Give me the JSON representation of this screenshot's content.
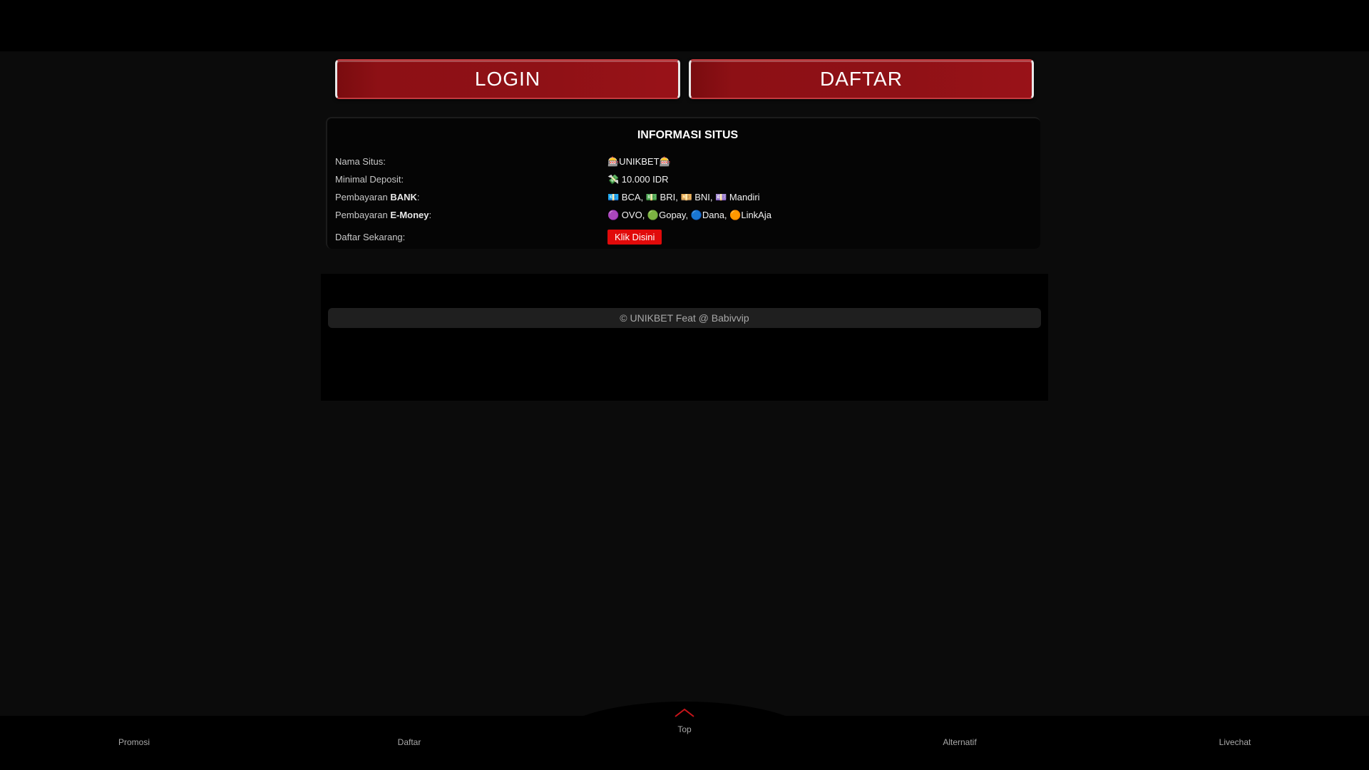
{
  "buttons": {
    "login": "LOGIN",
    "daftar": "DAFTAR"
  },
  "info": {
    "title": "INFORMASI SITUS",
    "rows": [
      {
        "label": "Nama Situs:",
        "value": "🎰UNIKBET🎰"
      },
      {
        "label": "Minimal Deposit:",
        "value": "💸 10.000 IDR"
      },
      {
        "label_prefix": "Pembayaran ",
        "label_bold": "BANK",
        "label_suffix": ":",
        "value": "💶 BCA, 💵 BRI, 💴 BNI, 💷 Mandiri"
      },
      {
        "label_prefix": "Pembayaran ",
        "label_bold": "E-Money",
        "label_suffix": ":",
        "value": "🟣 OVO, 🟢Gopay, 🔵Dana, 🟠LinkAja"
      },
      {
        "label": "Daftar Sekarang:",
        "button": "Klik Disini"
      }
    ]
  },
  "footer": {
    "copyright": "© UNIKBET Feat @ Babivvip"
  },
  "bottom_nav": {
    "items": [
      "Promosi",
      "Daftar",
      "Top",
      "Alternatif",
      "Livechat"
    ]
  },
  "colors": {
    "accent_red": "#8f1116",
    "cta_red": "#e10a0a",
    "background": "#0b0b0b"
  },
  "icons": {
    "top": "chevron-up-icon"
  }
}
